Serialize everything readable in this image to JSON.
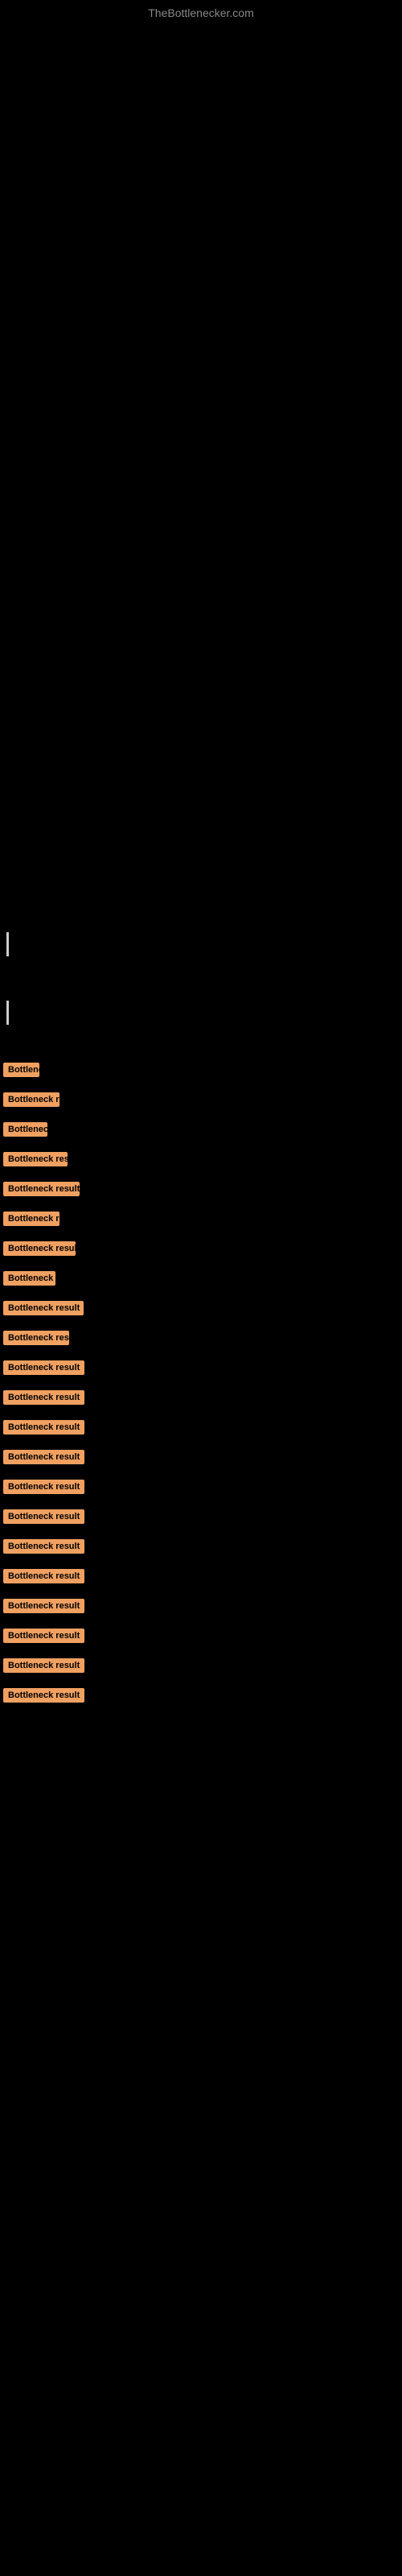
{
  "site": {
    "title": "TheBottlenecker.com"
  },
  "bottleneck_items": [
    {
      "id": 1,
      "label": "Bottleneck result",
      "badge_class": "badge-xs"
    },
    {
      "id": 2,
      "label": "Bottleneck result",
      "badge_class": "badge-sm"
    },
    {
      "id": 3,
      "label": "Bottleneck result",
      "badge_class": "badge-xs"
    },
    {
      "id": 4,
      "label": "Bottleneck result",
      "badge_class": "badge-md"
    },
    {
      "id": 5,
      "label": "Bottleneck result",
      "badge_class": "badge-md"
    },
    {
      "id": 6,
      "label": "Bottleneck result",
      "badge_class": "badge-sm"
    },
    {
      "id": 7,
      "label": "Bottleneck result",
      "badge_class": "badge-md"
    },
    {
      "id": 8,
      "label": "Bottleneck result",
      "badge_class": "badge-sm"
    },
    {
      "id": 9,
      "label": "Bottleneck result",
      "badge_class": "badge-md"
    },
    {
      "id": 10,
      "label": "Bottleneck result",
      "badge_class": "badge-sm"
    },
    {
      "id": 11,
      "label": "Bottleneck result",
      "badge_class": "badge-lg"
    },
    {
      "id": 12,
      "label": "Bottleneck result",
      "badge_class": "badge-lg"
    },
    {
      "id": 13,
      "label": "Bottleneck result",
      "badge_class": "badge-lg"
    },
    {
      "id": 14,
      "label": "Bottleneck result",
      "badge_class": "badge-lg"
    },
    {
      "id": 15,
      "label": "Bottleneck result",
      "badge_class": "badge-lg"
    },
    {
      "id": 16,
      "label": "Bottleneck result",
      "badge_class": "badge-lg"
    },
    {
      "id": 17,
      "label": "Bottleneck result",
      "badge_class": "badge-lg"
    },
    {
      "id": 18,
      "label": "Bottleneck result",
      "badge_class": "badge-lg"
    },
    {
      "id": 19,
      "label": "Bottleneck result",
      "badge_class": "badge-lg"
    },
    {
      "id": 20,
      "label": "Bottleneck result",
      "badge_class": "badge-lg"
    },
    {
      "id": 21,
      "label": "Bottleneck result",
      "badge_class": "badge-full"
    },
    {
      "id": 22,
      "label": "Bottleneck result",
      "badge_class": "badge-full"
    }
  ]
}
